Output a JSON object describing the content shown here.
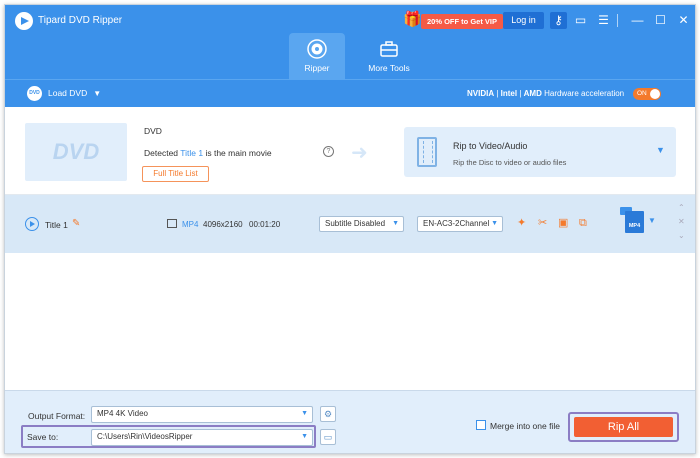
{
  "app": {
    "title": "Tipard DVD Ripper",
    "vip_label": "20% OFF to Get VIP",
    "login_label": "Log in",
    "accent_color": "#3b91ea",
    "orange_color": "#f47a2c"
  },
  "nav": {
    "tabs": [
      {
        "label": "Ripper",
        "active": true,
        "icon": "disc-icon"
      },
      {
        "label": "More Tools",
        "active": false,
        "icon": "toolbox-icon"
      }
    ]
  },
  "toolbar": {
    "load_label": "Load DVD",
    "hw_nvidia": "NVIDIA",
    "hw_intel": "Intel",
    "hw_amd": "AMD",
    "hw_label": "Hardware acceleration",
    "toggle_label": "ON"
  },
  "source": {
    "thumb_text": "DVD",
    "title": "DVD",
    "detected_prefix": "Detected",
    "detected_link": "Title 1",
    "detected_suffix": "is the main movie",
    "full_title_label": "Full Title List",
    "help_glyph": "?",
    "rip_title": "Rip to Video/Audio",
    "rip_subtitle": "Rip the Disc to video or audio files"
  },
  "title_row": {
    "name": "Title 1",
    "format": "MP4",
    "resolution": "4096x2160",
    "duration": "00:01:20",
    "subtitle": "Subtitle Disabled",
    "audio": "EN-AC3-2Channel",
    "badge": "MP4"
  },
  "bottom": {
    "output_format_label": "Output Format:",
    "output_format_value": "MP4 4K Video",
    "save_to_label": "Save to:",
    "save_to_value": "C:\\Users\\Rin\\VideosRipper",
    "merge_label": "Merge into one file",
    "merge_checked": false,
    "rip_all_label": "Rip All"
  }
}
